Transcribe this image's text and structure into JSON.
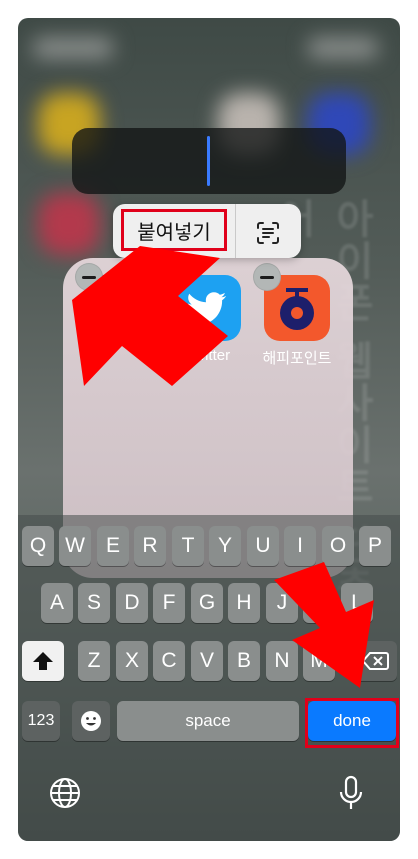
{
  "context_menu": {
    "paste_label": "붙여넣기"
  },
  "folder": {
    "apps": [
      {
        "label": "",
        "icon": "blue-app-icon"
      },
      {
        "label": "Twitter",
        "icon": "twitter-bird-icon",
        "color": "#1DA1F2"
      },
      {
        "label": "해피포인트",
        "icon": "happypoint-icon",
        "color": "#F3582C"
      }
    ]
  },
  "watermark_text": "아이폰 웹사이트 단축어",
  "keyboard": {
    "row1": [
      "Q",
      "W",
      "E",
      "R",
      "T",
      "Y",
      "U",
      "I",
      "O",
      "P"
    ],
    "row2": [
      "A",
      "S",
      "D",
      "F",
      "G",
      "H",
      "J",
      "K",
      "L"
    ],
    "row3": [
      "Z",
      "X",
      "C",
      "V",
      "B",
      "N",
      "M"
    ],
    "numbers_label": "123",
    "space_label": "space",
    "done_label": "done"
  },
  "colors": {
    "done": "#0A7AFF",
    "annotation": "#E0001A",
    "cursor": "#3A7BFF"
  }
}
